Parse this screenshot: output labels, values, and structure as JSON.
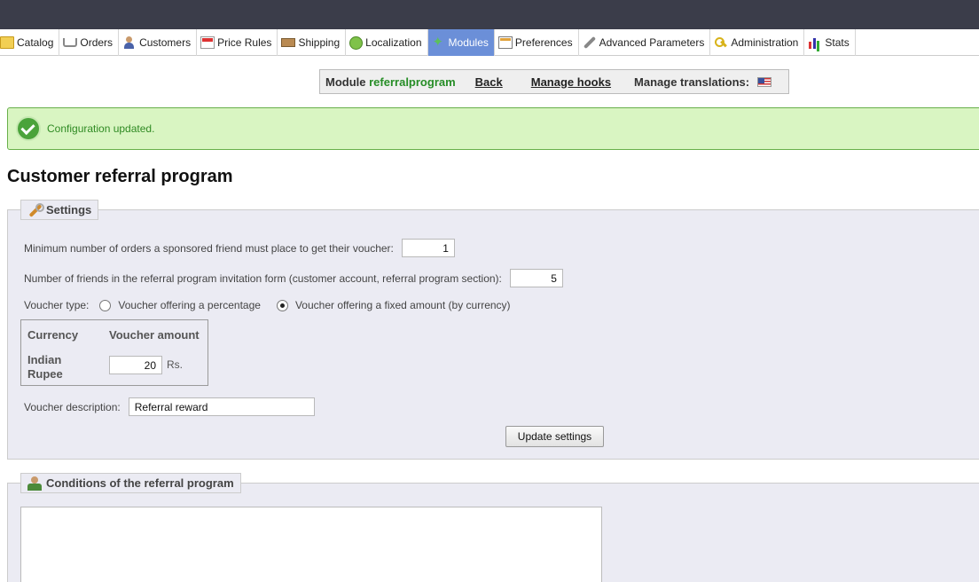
{
  "tabs": [
    {
      "label": "Catalog",
      "icon": "catalog-icon"
    },
    {
      "label": "Orders",
      "icon": "orders-icon"
    },
    {
      "label": "Customers",
      "icon": "customers-icon"
    },
    {
      "label": "Price Rules",
      "icon": "price-rules-icon"
    },
    {
      "label": "Shipping",
      "icon": "shipping-icon"
    },
    {
      "label": "Localization",
      "icon": "localization-icon"
    },
    {
      "label": "Modules",
      "icon": "modules-icon",
      "active": true
    },
    {
      "label": "Preferences",
      "icon": "preferences-icon"
    },
    {
      "label": "Advanced Parameters",
      "icon": "advanced-parameters-icon"
    },
    {
      "label": "Administration",
      "icon": "administration-icon"
    },
    {
      "label": "Stats",
      "icon": "stats-icon"
    }
  ],
  "module_bar": {
    "module_prefix": "Module",
    "module_name": "referralprogram",
    "back": "Back",
    "manage_hooks": "Manage hooks",
    "manage_translations": "Manage translations:"
  },
  "alert": {
    "text": "Configuration updated."
  },
  "page_title": "Customer referral program",
  "settings": {
    "legend": "Settings",
    "min_orders_label": "Minimum number of orders a sponsored friend must place to get their voucher:",
    "min_orders_value": "1",
    "friends_label": "Number of friends in the referral program invitation form (customer account, referral program section):",
    "friends_value": "5",
    "voucher_type_label": "Voucher type:",
    "voucher_percentage": "Voucher offering a percentage",
    "voucher_fixed": "Voucher offering a fixed amount (by currency)",
    "voucher_selected": "fixed",
    "currency_header": "Currency",
    "amount_header": "Voucher amount",
    "currency_name": "Indian Rupee",
    "currency_amount": "20",
    "currency_symbol": "Rs.",
    "description_label": "Voucher description:",
    "description_value": "Referral reward",
    "update_button": "Update settings"
  },
  "conditions": {
    "legend": "Conditions of the referral program"
  },
  "colors": {
    "topbar": "#3b3d4a",
    "active_tab": "#6b8fd8",
    "success_bg": "#d9f5c2",
    "success_text": "#2f8a23",
    "module_name": "#268d26",
    "fieldset_bg": "#ebebf3"
  }
}
